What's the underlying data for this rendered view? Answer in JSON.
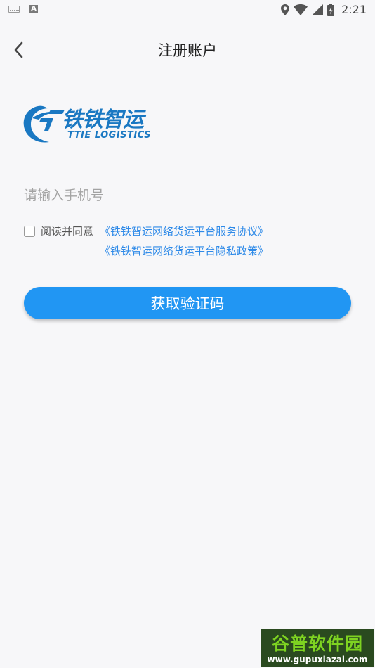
{
  "status_bar": {
    "time": "2:21",
    "left_icons": [
      "keyboard-icon",
      "text-a-icon"
    ],
    "right_icons": [
      "location-icon",
      "wifi-icon",
      "signal-icon",
      "battery-charging-icon"
    ],
    "text_a": "A"
  },
  "header": {
    "back_icon": "chevron-left-icon",
    "title": "注册账户"
  },
  "logo": {
    "cn": "铁铁智运",
    "en": "TTIE LOGISTICS",
    "color": "#1a78c2"
  },
  "form": {
    "phone_placeholder": "请输入手机号",
    "phone_value": "",
    "agree_checked": false,
    "agree_text": "阅读并同意",
    "service_agreement_link": "《铁铁智运网络货运平台服务协议》",
    "privacy_policy_link": "《铁铁智运网络货运平台隐私政策》",
    "submit_label": "获取验证码"
  },
  "watermark": {
    "title": "谷普软件园",
    "url": "www.gupuxiazai.com"
  },
  "colors": {
    "accent": "#2196f3",
    "link": "#2e8ae8",
    "background": "#f7f7f9"
  }
}
